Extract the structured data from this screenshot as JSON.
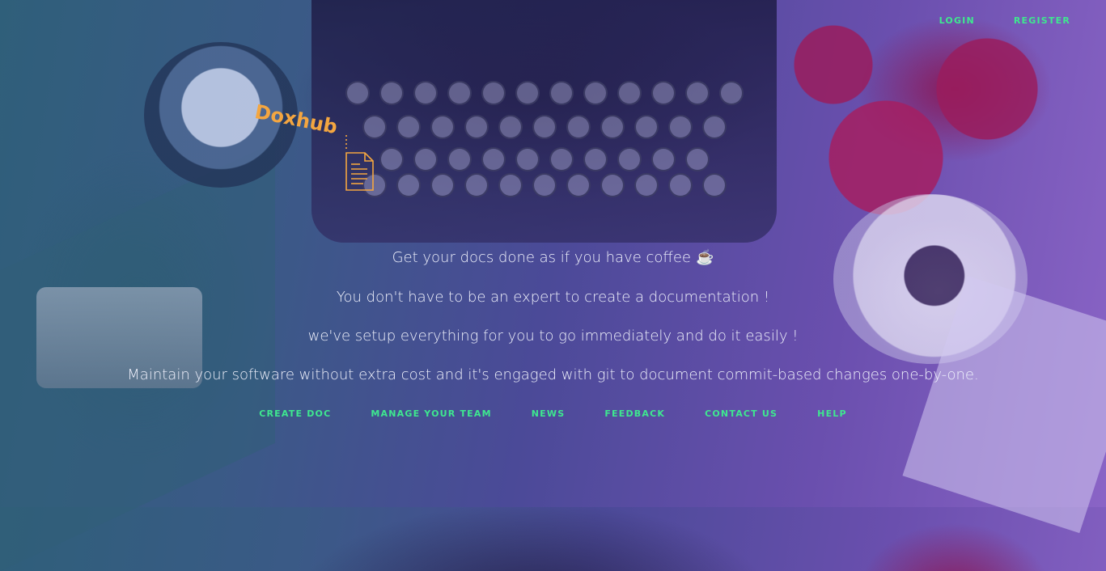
{
  "header": {
    "login_label": "LOGIN",
    "register_label": "REGISTER"
  },
  "logo": {
    "text": "Doxhub",
    "icon": "document-icon"
  },
  "hero": {
    "line1": "Get your docs done as if you have coffee",
    "line1_icon": "☕",
    "line2": "You don't have to be an expert to create a documentation !",
    "line3": "we've setup everything for you to go immediately and do it easily !",
    "line4": "Maintain your software without extra cost and it's engaged with git to document commit-based changes one-by-one."
  },
  "menu": {
    "items": [
      {
        "label": "CREATE DOC"
      },
      {
        "label": "MANAGE YOUR TEAM"
      },
      {
        "label": "NEWS"
      },
      {
        "label": "FEEDBACK"
      },
      {
        "label": "CONTACT US"
      },
      {
        "label": "HELP"
      }
    ]
  },
  "colors": {
    "accent_green": "#3ee88f",
    "logo_orange": "#f4a640"
  }
}
